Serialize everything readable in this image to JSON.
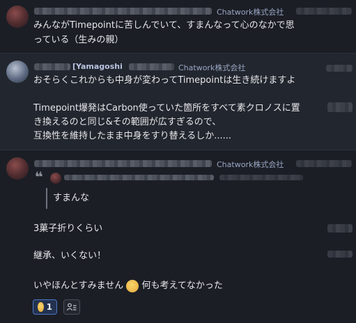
{
  "messages": [
    {
      "org": "Chatwork株式会社",
      "lines": [
        "みんながTimepointに苦しんでいて、すまんなって心のなかで思",
        "っている（生みの親）"
      ]
    },
    {
      "name": "[Yamagoshi",
      "org": "Chatwork株式会社",
      "lines": [
        "おそらくこれからも中身が変わってTimepointは生き続けますよ",
        "",
        "Timepoint爆発はCarbon使っていた箇所をすべて素クロノスに置",
        "き換えるのと同じ&その範囲が広すぎるので、",
        "互換性を維持したまま中身をすり替えるしか......"
      ]
    },
    {
      "org": "Chatwork株式会社",
      "quote_text": "すまんな",
      "lines": [
        "3菓子折りくらい",
        "継承、いくない！",
        "いやほんとすみません",
        "何も考えてなかった"
      ],
      "reaction": {
        "emoji": "smiling-face-icon",
        "count": "1"
      }
    }
  ]
}
